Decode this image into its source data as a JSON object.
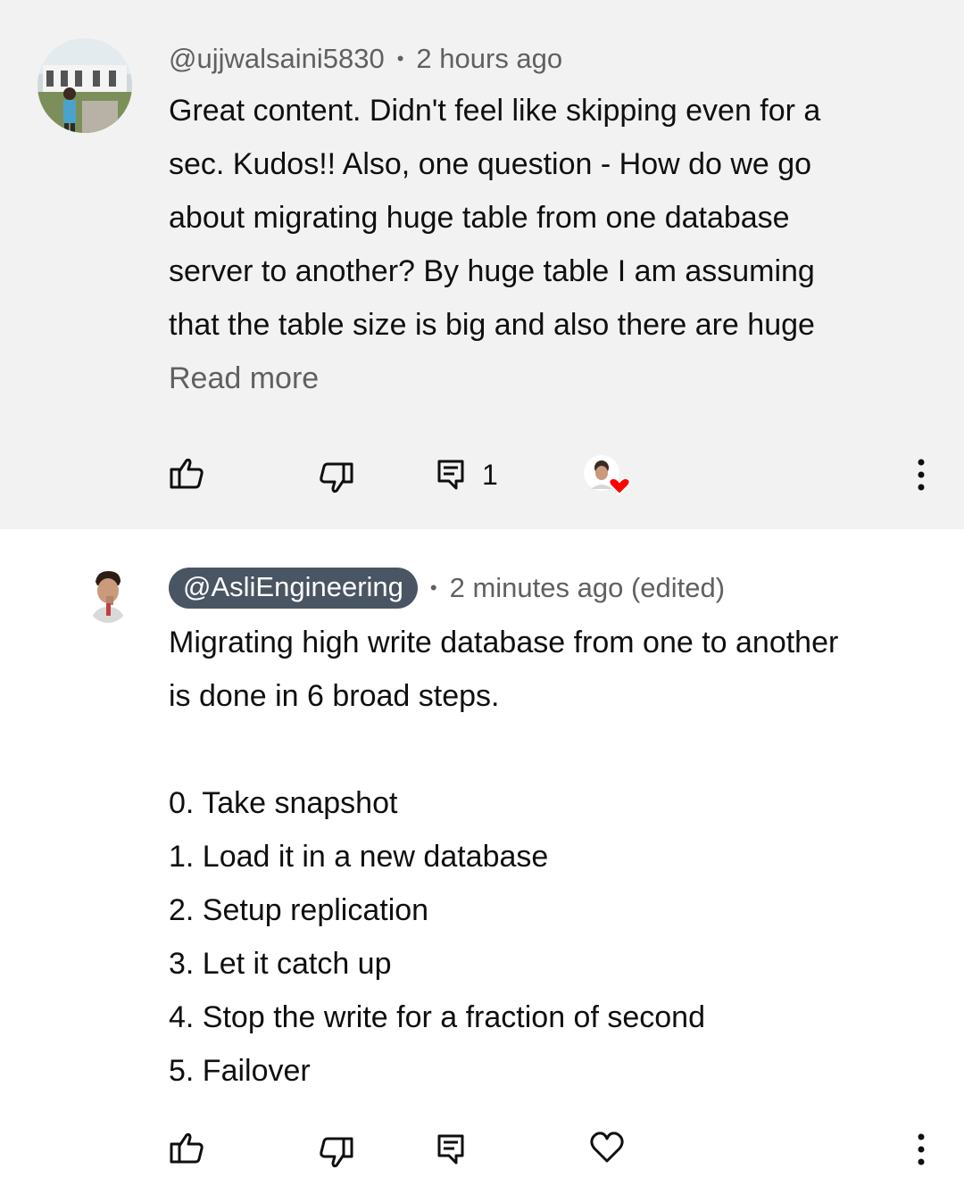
{
  "comments": [
    {
      "author": "@ujjwalsaini5830",
      "separator": "•",
      "time": "2 hours ago",
      "lines": [
        "Great content. Didn't feel like skipping even for a",
        "sec. Kudos!! Also, one question - How do we go",
        "about migrating huge table from one database",
        "server to another? By huge table I am assuming",
        "that the table size is big and also there are huge"
      ],
      "read_more": "Read more",
      "reply_count": "1"
    },
    {
      "author": "@AsliEngineering",
      "separator": "•",
      "time": "2 minutes ago (edited)",
      "lines": [
        "Migrating high write database from one to another",
        "is done in 6 broad steps.",
        "",
        "0. Take snapshot",
        "1. Load it in a new database",
        "2. Setup replication",
        "3. Let it catch up",
        "4. Stop the write for a fraction of second",
        "5. Failover"
      ]
    }
  ],
  "icons": {
    "like": "thumbs-up-icon",
    "dislike": "thumbs-down-icon",
    "reply": "reply-icon",
    "creator_heart": "creator-heart-badge",
    "heart": "heart-icon",
    "more": "more-vert-icon"
  },
  "colors": {
    "chip_bg": "#4a5563",
    "heart_red": "#ff0000",
    "meta_gray": "#606060"
  }
}
